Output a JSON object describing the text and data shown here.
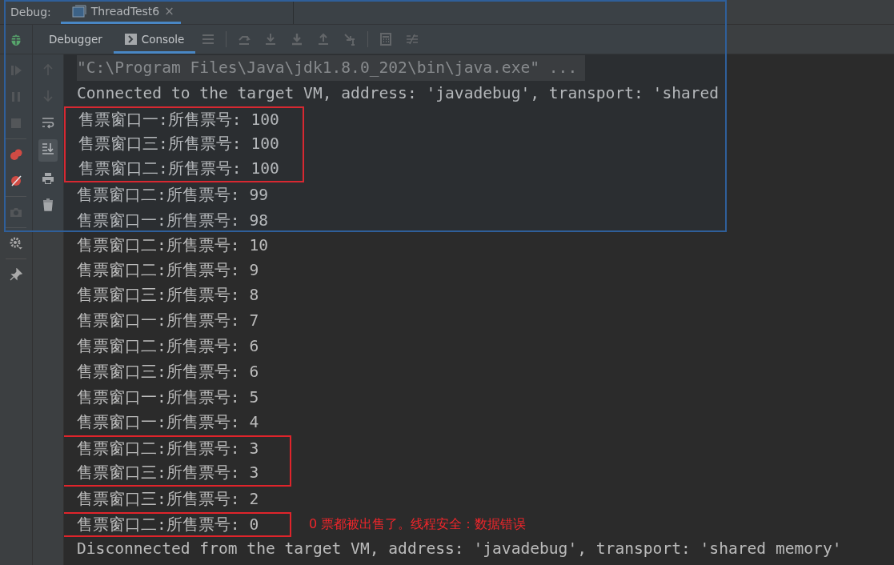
{
  "debug_bar": {
    "label": "Debug:",
    "tabs": [
      {
        "label": "ThreadTest6",
        "selected": true,
        "close": "×"
      }
    ]
  },
  "toolbar": {
    "tabs": [
      {
        "label": "Debugger",
        "selected": false
      },
      {
        "label": "Console",
        "selected": true
      }
    ]
  },
  "gutter": {
    "scroll_to_end": true
  },
  "console": {
    "blocks": [
      {
        "kind": "command",
        "text": "\"C:\\Program Files\\Java\\jdk1.8.0_202\\bin\\java.exe\" ..."
      },
      {
        "kind": "line",
        "text": "Connected to the target VM, address: 'javadebug', transport: 'shared"
      },
      {
        "kind": "boxed",
        "lines": [
          "售票窗口一:所售票号: 100",
          "售票窗口三:所售票号: 100",
          "售票窗口二:所售票号: 100"
        ]
      },
      {
        "kind": "line",
        "text": "售票窗口二:所售票号: 99"
      },
      {
        "kind": "line",
        "text": "售票窗口一:所售票号: 98"
      },
      {
        "kind": "clipped_top",
        "text": "售票窗口二:所售票号: 10"
      },
      {
        "kind": "line",
        "text": "售票窗口二:所售票号: 9"
      },
      {
        "kind": "line",
        "text": "售票窗口三:所售票号: 8"
      },
      {
        "kind": "line",
        "text": "售票窗口一:所售票号: 7"
      },
      {
        "kind": "line",
        "text": "售票窗口二:所售票号: 6"
      },
      {
        "kind": "line",
        "text": "售票窗口三:所售票号: 6"
      },
      {
        "kind": "line",
        "text": "售票窗口一:所售票号: 5"
      },
      {
        "kind": "line",
        "text": "售票窗口一:所售票号: 4"
      },
      {
        "kind": "boxed",
        "wide": true,
        "lines": [
          "售票窗口二:所售票号: 3",
          "售票窗口三:所售票号: 3"
        ]
      },
      {
        "kind": "line",
        "text": "售票窗口三:所售票号: 2"
      },
      {
        "kind": "boxed",
        "wide": true,
        "lines": [
          "售票窗口二:所售票号: 0"
        ],
        "note": "0 票都被出售了。线程安全：数据错误"
      },
      {
        "kind": "clipped_bottom",
        "text": "Disconnected from the target VM, address: 'javadebug', transport: 'shared memory'"
      }
    ]
  }
}
